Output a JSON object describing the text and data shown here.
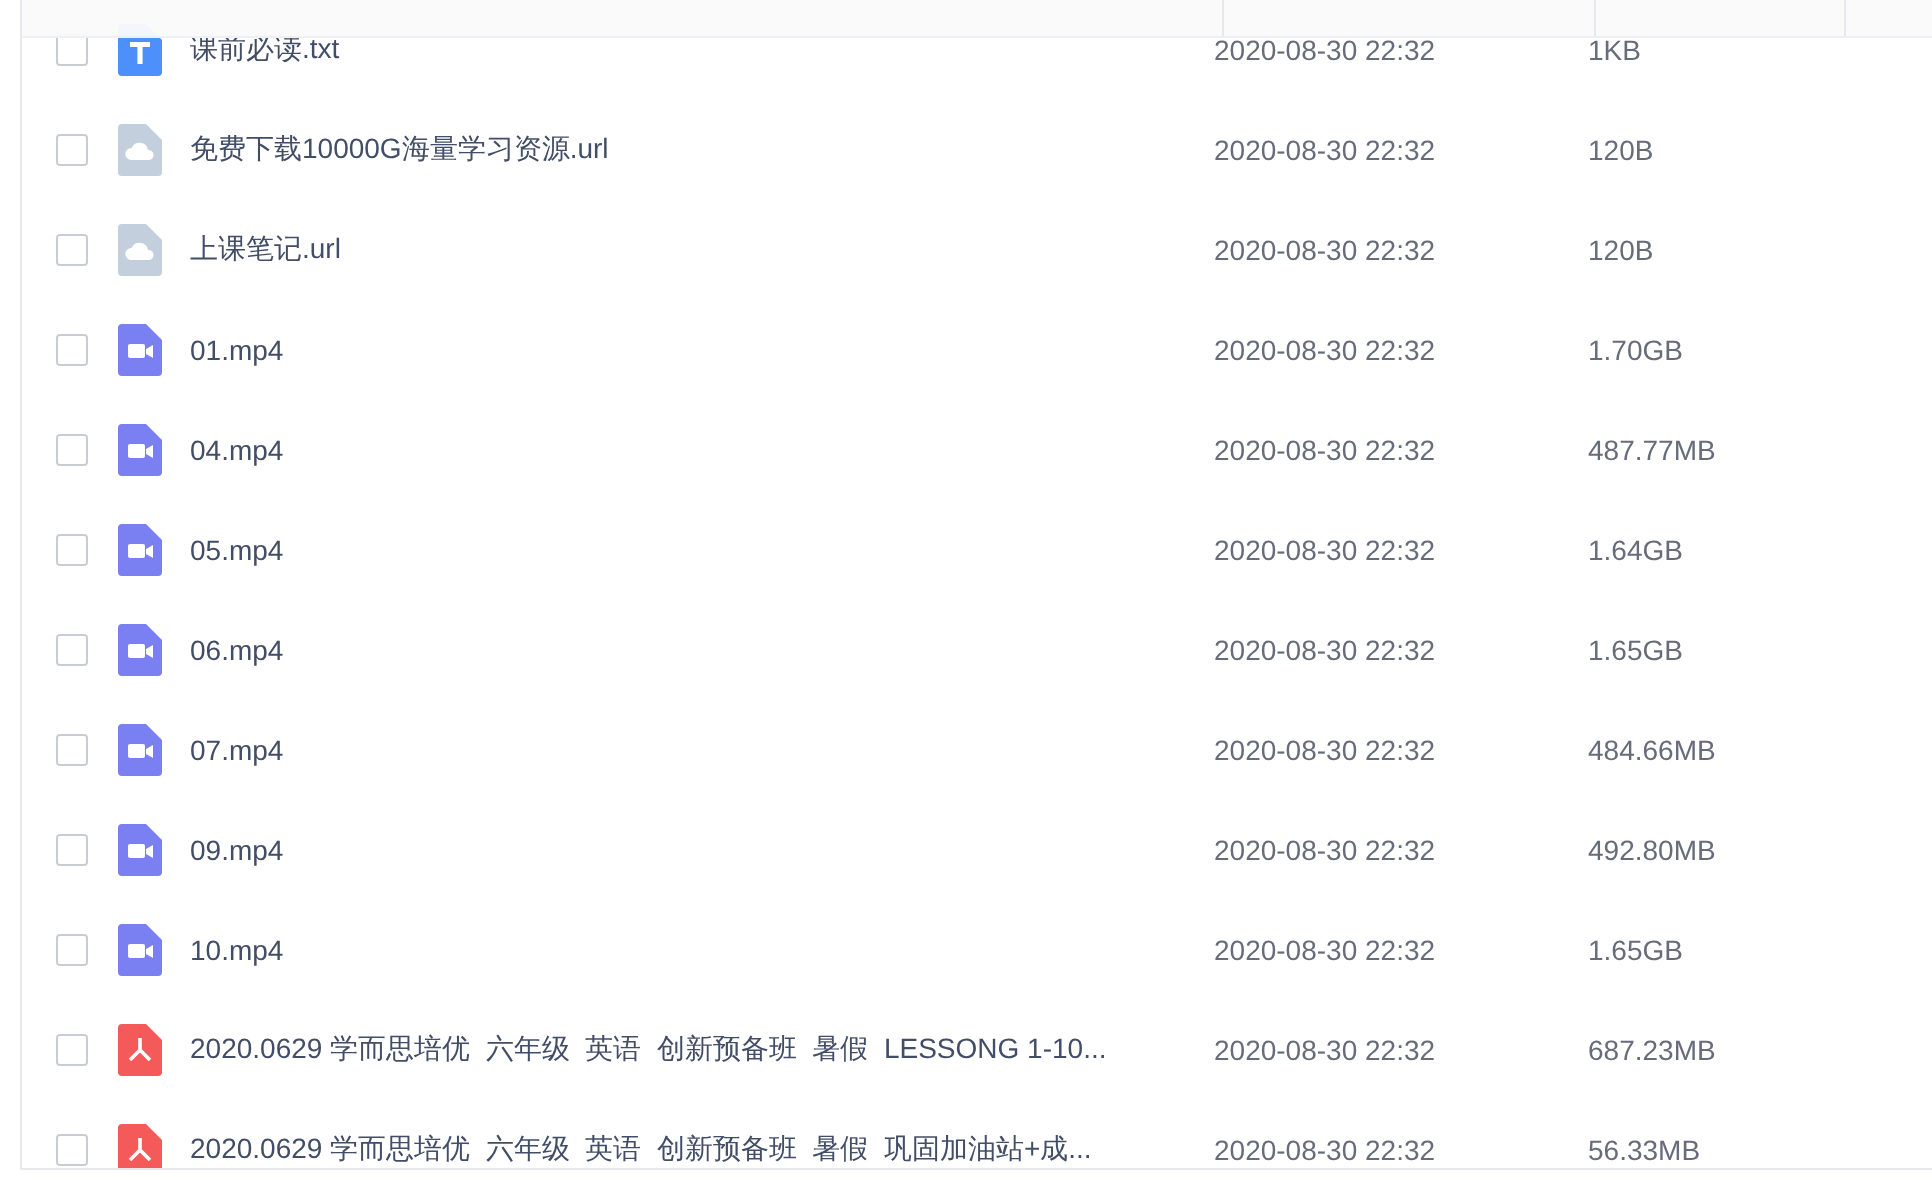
{
  "files": [
    {
      "kind": "txt",
      "name": "课前必读.txt",
      "modified": "2020-08-30 22:32",
      "size": "1KB",
      "checked": false
    },
    {
      "kind": "link",
      "name": "免费下载10000G海量学习资源.url",
      "modified": "2020-08-30 22:32",
      "size": "120B",
      "checked": false
    },
    {
      "kind": "link",
      "name": "上课笔记.url",
      "modified": "2020-08-30 22:32",
      "size": "120B",
      "checked": false
    },
    {
      "kind": "video",
      "name": "01.mp4",
      "modified": "2020-08-30 22:32",
      "size": "1.70GB",
      "checked": false
    },
    {
      "kind": "video",
      "name": "04.mp4",
      "modified": "2020-08-30 22:32",
      "size": "487.77MB",
      "checked": false
    },
    {
      "kind": "video",
      "name": "05.mp4",
      "modified": "2020-08-30 22:32",
      "size": "1.64GB",
      "checked": false
    },
    {
      "kind": "video",
      "name": "06.mp4",
      "modified": "2020-08-30 22:32",
      "size": "1.65GB",
      "checked": false
    },
    {
      "kind": "video",
      "name": "07.mp4",
      "modified": "2020-08-30 22:32",
      "size": "484.66MB",
      "checked": false
    },
    {
      "kind": "video",
      "name": "09.mp4",
      "modified": "2020-08-30 22:32",
      "size": "492.80MB",
      "checked": false
    },
    {
      "kind": "video",
      "name": "10.mp4",
      "modified": "2020-08-30 22:32",
      "size": "1.65GB",
      "checked": false
    },
    {
      "kind": "pdf",
      "name": "2020.0629 学而思培优  六年级  英语  创新预备班  暑假  LESSONG 1-10...",
      "modified": "2020-08-30 22:32",
      "size": "687.23MB",
      "checked": false
    },
    {
      "kind": "pdf",
      "name": "2020.0629 学而思培优  六年级  英语  创新预备班  暑假  巩固加油站+成...",
      "modified": "2020-08-30 22:32",
      "size": "56.33MB",
      "checked": false
    }
  ]
}
